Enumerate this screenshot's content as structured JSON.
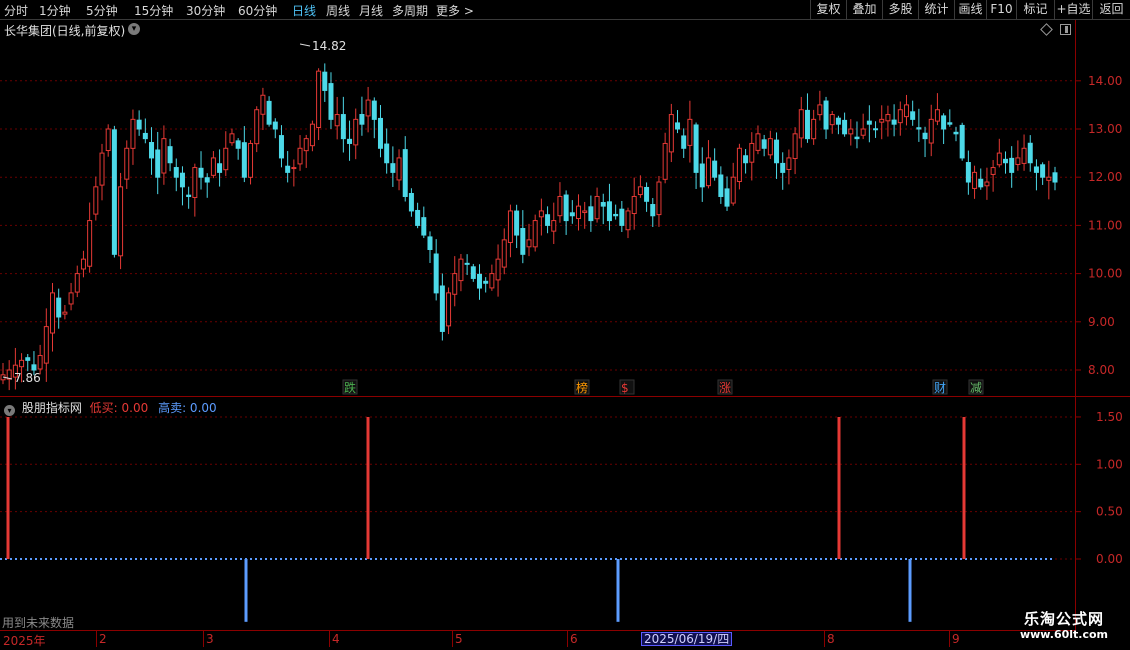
{
  "toolbar": {
    "periods": [
      "分时",
      "1分钟",
      "5分钟",
      "15分钟",
      "30分钟",
      "60分钟",
      "日线",
      "周线",
      "月线",
      "多周期",
      "更多 >"
    ],
    "active_period": "日线",
    "right_buttons": [
      "复权",
      "叠加",
      "多股",
      "统计",
      "画线",
      "F10",
      "+自选",
      "返回"
    ],
    "corner_label": "标记"
  },
  "stock": {
    "title": "长华集团(日线,前复权)"
  },
  "price_axis": {
    "ticks": [
      "14.00",
      "13.00",
      "12.00",
      "11.00",
      "10.00",
      "9.00",
      "8.00"
    ]
  },
  "price_annotations": {
    "high": "14.82",
    "low": "7.86"
  },
  "event_markers": [
    {
      "label": "跌",
      "color": "#4caf50"
    },
    {
      "label": "榜",
      "color": "#ff9800"
    },
    {
      "label": "$",
      "color": "#e53935"
    },
    {
      "label": "涨",
      "color": "#e53935"
    },
    {
      "label": "财",
      "color": "#42a5f5"
    },
    {
      "label": "减",
      "color": "#66bb6a"
    }
  ],
  "indicator": {
    "name": "股朋指标网",
    "low_buy_label": "低买: 0.00",
    "high_sell_label": "高卖: 0.00",
    "low_buy_color": "#e53935",
    "high_sell_color": "#5c9cff",
    "axis_ticks": [
      "1.50",
      "1.00",
      "0.50",
      "0.00"
    ]
  },
  "future_note": "用到未来数据",
  "date_axis": {
    "labels": [
      "2025年",
      "2",
      "3",
      "4",
      "5",
      "6",
      "8",
      "9"
    ],
    "cursor_date": "2025/06/19/四"
  },
  "watermark": {
    "title": "乐淘公式网",
    "url": "www.60lt.com"
  },
  "colors": {
    "up": "#e53935",
    "down": "#4dd9e8",
    "grid": "#6a0000",
    "axis": "#8b0000"
  },
  "chart_data": {
    "type": "candlestick",
    "y_range": [
      7.7,
      15.0
    ],
    "closes_approx": [
      7.9,
      8.0,
      8.1,
      8.2,
      8.2,
      8.0,
      8.3,
      8.9,
      9.6,
      9.1,
      9.2,
      9.6,
      10.0,
      10.3,
      11.1,
      11.8,
      12.5,
      13.0,
      10.4,
      11.8,
      12.6,
      13.2,
      13.0,
      12.8,
      12.4,
      12.0,
      12.8,
      12.3,
      12.0,
      11.8,
      11.6,
      12.2,
      12.0,
      11.9,
      12.4,
      12.1,
      12.6,
      12.9,
      12.6,
      12.0,
      12.7,
      13.4,
      13.7,
      13.1,
      13.0,
      12.4,
      12.1,
      12.2,
      12.6,
      12.8,
      13.1,
      14.2,
      13.8,
      13.2,
      13.3,
      12.8,
      12.7,
      13.2,
      13.1,
      13.6,
      13.2,
      12.6,
      12.3,
      12.1,
      12.4,
      11.6,
      11.3,
      11.0,
      10.8,
      10.5,
      9.6,
      8.8,
      9.6,
      10.0,
      10.3,
      10.2,
      9.9,
      9.7,
      9.8,
      10.0,
      10.3,
      10.7,
      11.3,
      10.8,
      10.4,
      10.7,
      11.1,
      11.3,
      11.0,
      11.1,
      11.6,
      11.1,
      11.2,
      11.4,
      11.3,
      11.1,
      11.6,
      11.4,
      11.1,
      11.2,
      11.0,
      11.3,
      11.6,
      11.8,
      11.5,
      11.2,
      11.9,
      12.7,
      13.3,
      13.0,
      12.6,
      13.2,
      12.1,
      11.8,
      12.4,
      12.0,
      11.6,
      11.4,
      12.0,
      12.6,
      12.3,
      12.7,
      12.9,
      12.6,
      12.8,
      12.3,
      12.1,
      12.4,
      12.9,
      13.4,
      12.8,
      13.2,
      13.5,
      13.0,
      13.3,
      13.1,
      12.9,
      13.0,
      12.8,
      13.0,
      13.1,
      13.0,
      13.2,
      13.3,
      13.1,
      13.4,
      13.5,
      13.2,
      13.0,
      12.8,
      13.2,
      13.4,
      13.0,
      13.1,
      12.9,
      12.4,
      11.9,
      12.1,
      11.8,
      11.9,
      12.2,
      12.5,
      12.3,
      12.1,
      12.4,
      12.6,
      12.3,
      12.1,
      12.0,
      12.0,
      11.9
    ],
    "indicator_low_buy_bars_x_index": [
      0,
      72,
      164,
      190
    ],
    "indicator_high_sell_bars_x_index": [
      48,
      123,
      178
    ],
    "low_buy_value": 1.5,
    "high_sell_value": -0.6
  }
}
